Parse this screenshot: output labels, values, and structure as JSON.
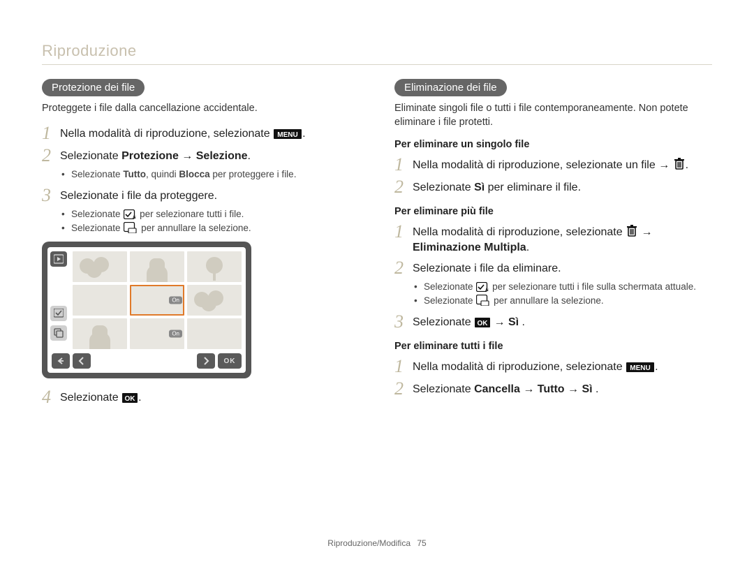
{
  "header": {
    "title": "Riproduzione"
  },
  "left": {
    "pill": "Protezione dei file",
    "intro": "Proteggete i file dalla cancellazione accidentale.",
    "steps": {
      "s1": "Nella modalità di riproduzione, selezionate ",
      "s2_pre": "Selezionate ",
      "s2_bold": "Protezione → Selezione",
      "s2_post": ".",
      "s2_sub1_pre": "Selezionate ",
      "s2_sub1_b1": "Tutto",
      "s2_sub1_mid": ", quindi ",
      "s2_sub1_b2": "Blocca",
      "s2_sub1_post": " per proteggere i file.",
      "s3": "Selezionate i file da proteggere.",
      "s3_sub1_pre": "Selezionate ",
      "s3_sub1_post": " per selezionare tutti i file.",
      "s3_sub2_pre": "Selezionate ",
      "s3_sub2_post": " per annullare la selezione.",
      "s4": "Selezionate ",
      "s4_post": "."
    },
    "thumb": {
      "tag1": "On",
      "tag2": "On",
      "ok": "OK"
    }
  },
  "right": {
    "pill": "Eliminazione dei file",
    "intro": "Eliminate singoli file o tutti i file contemporaneamente. Non potete eliminare i file protetti.",
    "h_single": "Per eliminare un singolo file",
    "single": {
      "s1_pre": "Nella modalità di riproduzione, selezionate un file → ",
      "s1_post": ".",
      "s2_pre": "Selezionate ",
      "s2_b": "Sì",
      "s2_post": " per eliminare il file."
    },
    "h_multi": "Per eliminare più file",
    "multi": {
      "s1_pre": "Nella modalità di riproduzione, selezionate ",
      "s1_mid": " → ",
      "s1_b": "Eliminazione Multipla",
      "s1_post": ".",
      "s2": "Selezionate i file da eliminare.",
      "s2_sub1_pre": "Selezionate ",
      "s2_sub1_post": " per selezionare tutti i file sulla schermata attuale.",
      "s2_sub2_pre": "Selezionate ",
      "s2_sub2_post": " per annullare la selezione.",
      "s3_pre": "Selezionate ",
      "s3_mid": " → ",
      "s3_b": "Sì",
      "s3_post": " ."
    },
    "h_all": "Per eliminare tutti i file",
    "all": {
      "s1": "Nella modalità di riproduzione, selezionate ",
      "s1_post": ".",
      "s2_pre": "Selezionate ",
      "s2_b": "Cancella → Tutto → Sì",
      "s2_post": " ."
    }
  },
  "footer": {
    "section": "Riproduzione/Modifica",
    "page": "75"
  }
}
